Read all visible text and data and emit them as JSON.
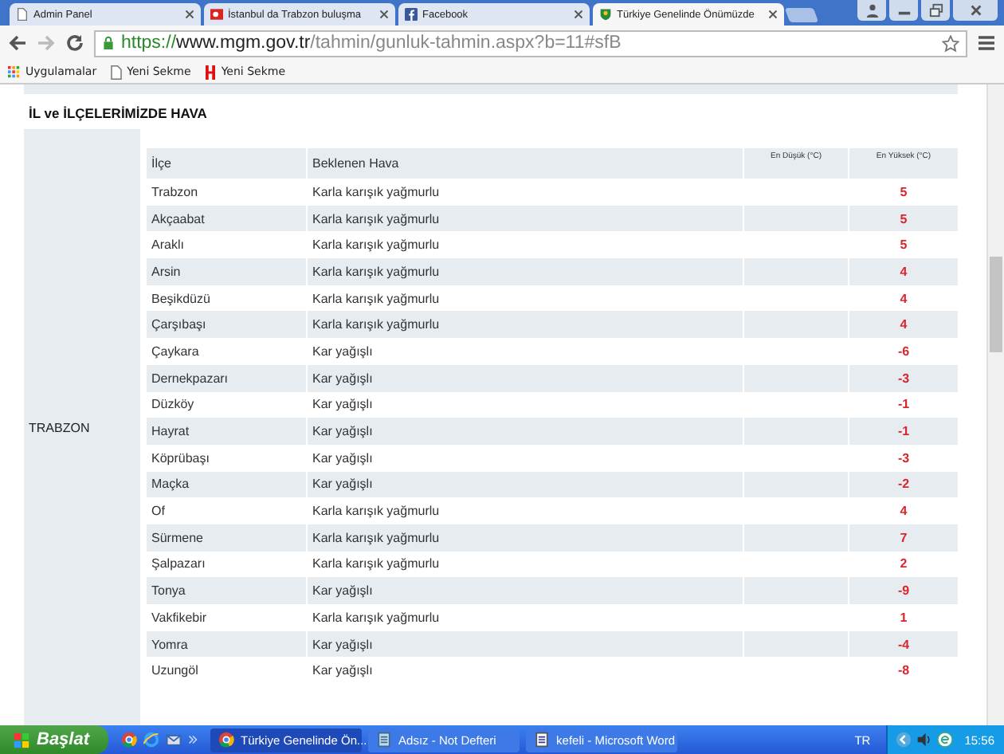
{
  "browser": {
    "tabs": [
      {
        "title": "Admin Panel",
        "selected": false
      },
      {
        "title": "İstanbul da Trabzon buluşma",
        "selected": false
      },
      {
        "title": "Facebook",
        "selected": false
      },
      {
        "title": "Türkiye Genelinde Önümüzde",
        "selected": true
      }
    ],
    "url": {
      "scheme": "https://",
      "host": "www.mgm.gov.tr",
      "path": "/tahmin/gunluk-tahmin.aspx?b=11#sfB"
    },
    "bookmarks": [
      {
        "label": "Uygulamalar"
      },
      {
        "label": "Yeni Sekme"
      },
      {
        "label": "Yeni Sekme"
      }
    ]
  },
  "page": {
    "section_title": "İL ve İLÇELERİMİZDE HAVA",
    "province": "TRABZON",
    "table": {
      "columns": [
        "İlçe",
        "Beklenen Hava",
        "En Düşük (°C)",
        "En Yüksek (°C)"
      ],
      "rows": [
        {
          "district": "Trabzon",
          "forecast": "Karla karışık yağmurlu",
          "high": "5"
        },
        {
          "district": "Akçaabat",
          "forecast": "Karla karışık yağmurlu",
          "high": "5"
        },
        {
          "district": "Araklı",
          "forecast": "Karla karışık yağmurlu",
          "high": "5"
        },
        {
          "district": "Arsin",
          "forecast": "Karla karışık yağmurlu",
          "high": "4"
        },
        {
          "district": "Beşikdüzü",
          "forecast": "Karla karışık yağmurlu",
          "high": "4"
        },
        {
          "district": "Çarşıbaşı",
          "forecast": "Karla karışık yağmurlu",
          "high": "4"
        },
        {
          "district": "Çaykara",
          "forecast": "Kar yağışlı",
          "high": "-6"
        },
        {
          "district": "Dernekpazarı",
          "forecast": "Kar yağışlı",
          "high": "-3"
        },
        {
          "district": "Düzköy",
          "forecast": "Kar yağışlı",
          "high": "-1"
        },
        {
          "district": "Hayrat",
          "forecast": "Kar yağışlı",
          "high": "-1"
        },
        {
          "district": "Köprübaşı",
          "forecast": "Kar yağışlı",
          "high": "-3"
        },
        {
          "district": "Maçka",
          "forecast": "Kar yağışlı",
          "high": "-2"
        },
        {
          "district": "Of",
          "forecast": "Karla karışık yağmurlu",
          "high": "4"
        },
        {
          "district": "Sürmene",
          "forecast": "Karla karışık yağmurlu",
          "high": "7"
        },
        {
          "district": "Şalpazarı",
          "forecast": "Karla karışık yağmurlu",
          "high": "2"
        },
        {
          "district": "Tonya",
          "forecast": "Kar yağışlı",
          "high": "-9"
        },
        {
          "district": "Vakfikebir",
          "forecast": "Karla karışık yağmurlu",
          "high": "1"
        },
        {
          "district": "Yomra",
          "forecast": "Kar yağışlı",
          "high": "-4"
        },
        {
          "district": "Uzungöl",
          "forecast": "Kar yağışlı",
          "high": "-8"
        }
      ]
    }
  },
  "taskbar": {
    "start": "Başlat",
    "windows": [
      {
        "title": "Türkiye Genelinde Ön...",
        "selected": true
      },
      {
        "title": "Adsız - Not Defteri",
        "selected": false
      },
      {
        "title": "kefeli - Microsoft Word",
        "selected": false
      }
    ],
    "language": "TR",
    "time": "15:56"
  }
}
